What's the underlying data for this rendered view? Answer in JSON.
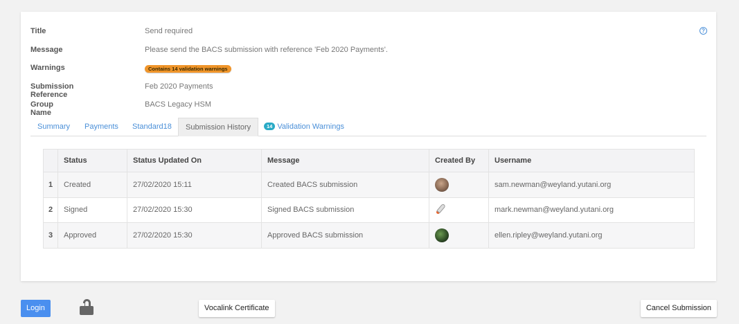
{
  "details": [
    {
      "label": "Title",
      "value": "Send required"
    },
    {
      "label": "Message",
      "value": "Please send the BACS submission with reference 'Feb 2020 Payments'."
    },
    {
      "label": "Warnings",
      "badge": "Contains 14 validation warnings"
    },
    {
      "label": "Submission Reference",
      "value": "Feb 2020 Payments"
    },
    {
      "label": "Group Name",
      "value": "BACS Legacy HSM"
    }
  ],
  "help_icon": "question-circle-icon",
  "tabs": [
    {
      "label": "Summary"
    },
    {
      "label": "Payments"
    },
    {
      "label": "Standard18"
    },
    {
      "label": "Submission History",
      "active": true
    },
    {
      "label": "Validation Warnings",
      "count": "14"
    }
  ],
  "table": {
    "headers": [
      "",
      "Status",
      "Status Updated On",
      "Message",
      "Created By",
      "Username"
    ],
    "rows": [
      {
        "num": "1",
        "status": "Created",
        "updated": "27/02/2020 15:11",
        "message": "Created BACS submission",
        "avatar": "avatar-photo-icon",
        "username": "sam.newman@weyland.yutani.org"
      },
      {
        "num": "2",
        "status": "Signed",
        "updated": "27/02/2020 15:30",
        "message": "Signed BACS submission",
        "avatar": "rocket-icon",
        "username": "mark.newman@weyland.yutani.org"
      },
      {
        "num": "3",
        "status": "Approved",
        "updated": "27/02/2020 15:30",
        "message": "Approved BACS submission",
        "avatar": "avatar-photo-icon",
        "username": "ellen.ripley@weyland.yutani.org"
      }
    ]
  },
  "footer": {
    "login_label": "Login",
    "lock_icon": "unlocked-icon",
    "vocalink_label": "Vocalink Certificate",
    "cancel_label": "Cancel Submission"
  },
  "colors": {
    "accent": "#4a8fef",
    "warning_badge": "#f0952a",
    "count_badge": "#29aac6"
  }
}
